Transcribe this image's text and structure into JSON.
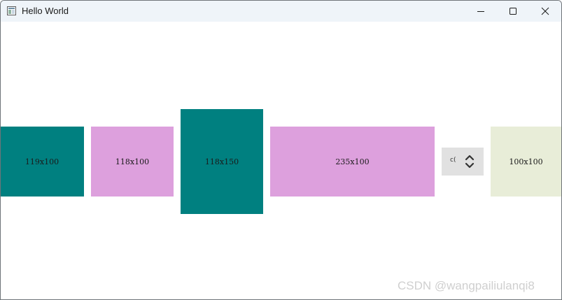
{
  "window": {
    "title": "Hello World"
  },
  "title_controls": {
    "minimize_icon": "minimize-icon",
    "maximize_icon": "maximize-icon",
    "close_icon": "close-icon"
  },
  "boxes": [
    {
      "label": "119x100",
      "color": "#008080"
    },
    {
      "label": "118x100",
      "color": "#dda0dd"
    },
    {
      "label": "118x150",
      "color": "#008080"
    },
    {
      "label": "235x100",
      "color": "#dda0dd"
    },
    {
      "label": "100x100",
      "color": "#e8edd8"
    }
  ],
  "spinbox": {
    "value": "c("
  },
  "watermark": {
    "text": "CSDN @wangpailiulanqi8"
  }
}
